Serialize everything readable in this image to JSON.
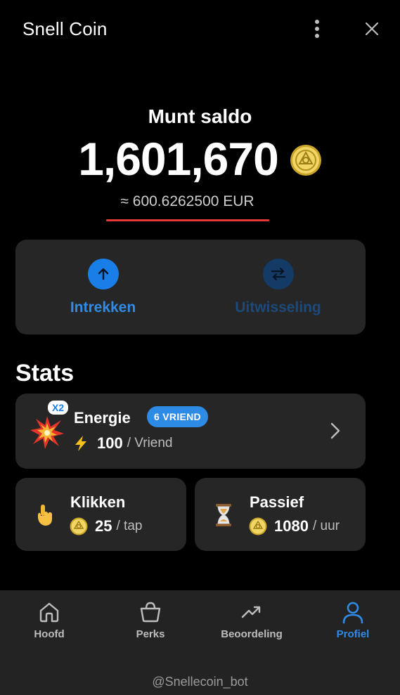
{
  "header": {
    "title": "Snell Coin"
  },
  "balance": {
    "label": "Munt saldo",
    "value": "1,601,670",
    "eur": "≈ 600.6262500 EUR"
  },
  "actions": [
    {
      "label": "Intrekken",
      "icon": "arrow-up-icon"
    },
    {
      "label": "Uitwisseling",
      "icon": "exchange-icon"
    }
  ],
  "stats": {
    "title": "Stats",
    "energie": {
      "title": "Energie",
      "multiplier": "X2",
      "badge": "6 VRIEND",
      "value": "100",
      "unit": "/ Vriend"
    },
    "klikken": {
      "title": "Klikken",
      "value": "25",
      "unit": "/ tap"
    },
    "passief": {
      "title": "Passief",
      "value": "1080",
      "unit": "/ uur"
    }
  },
  "nav": {
    "items": [
      {
        "label": "Hoofd",
        "icon": "home-icon"
      },
      {
        "label": "Perks",
        "icon": "bag-icon"
      },
      {
        "label": "Beoordeling",
        "icon": "trend-icon"
      },
      {
        "label": "Profiel",
        "icon": "profile-icon",
        "active": true
      }
    ],
    "handle": "@Snellecoin_bot"
  },
  "colors": {
    "accent": "#2f8be6",
    "underline": "#e53935",
    "card": "#262626"
  }
}
